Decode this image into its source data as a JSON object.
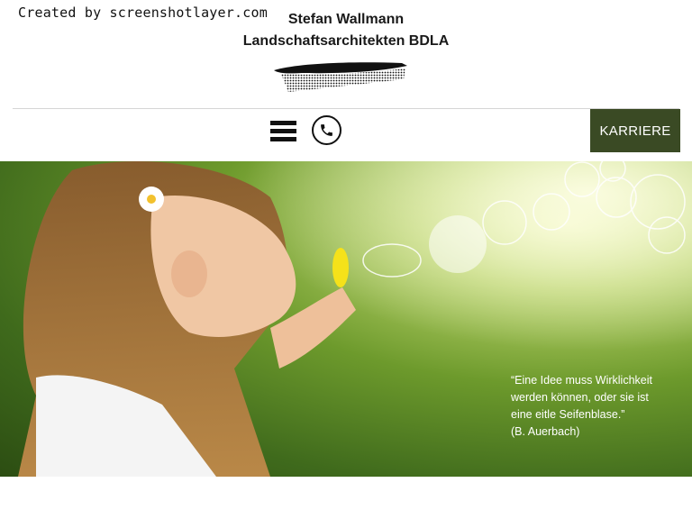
{
  "watermark": "Created by screenshotlayer.com",
  "header": {
    "name": "Stefan Wallmann",
    "subtitle": "Landschaftsarchitekten BDLA"
  },
  "nav": {
    "menu_icon": "hamburger-menu-icon",
    "phone_icon": "phone-icon",
    "career_label": "KARRIERE"
  },
  "hero": {
    "quote_lines": [
      "“Eine Idee muss Wirklichkeit",
      "werden können, oder sie ist",
      "eine eitle Seifenblase.”"
    ],
    "quote_author": "(B. Auerbach)"
  },
  "colors": {
    "career_bg": "#3a4a24",
    "hero_green": "#6d9a2c"
  }
}
